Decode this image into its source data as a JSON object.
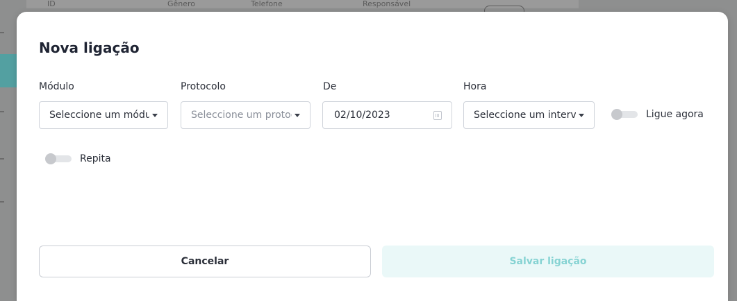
{
  "background": {
    "columns": [
      "ID",
      "Gênero",
      "Telefone",
      "Responsável"
    ]
  },
  "modal": {
    "title": "Nova ligação",
    "fields": {
      "module": {
        "label": "Módulo",
        "value": "Seleccione um módulo"
      },
      "protocol": {
        "label": "Protocolo",
        "placeholder": "Seleccione um protocolo"
      },
      "date": {
        "label": "De",
        "value": "02/10/2023"
      },
      "hour": {
        "label": "Hora",
        "value": "Seleccione um intervalo"
      }
    },
    "toggles": {
      "call_now": {
        "label": "Ligue agora",
        "checked": false
      },
      "repeat": {
        "label": "Repita",
        "checked": false
      }
    },
    "buttons": {
      "cancel": "Cancelar",
      "save": "Salvar ligação"
    }
  },
  "colors": {
    "save_bg": "#eaf8f8",
    "save_text": "#86d3d3",
    "accent": "#3aa7a8"
  },
  "icons": [
    "chevron-down-icon",
    "calendar-icon"
  ]
}
